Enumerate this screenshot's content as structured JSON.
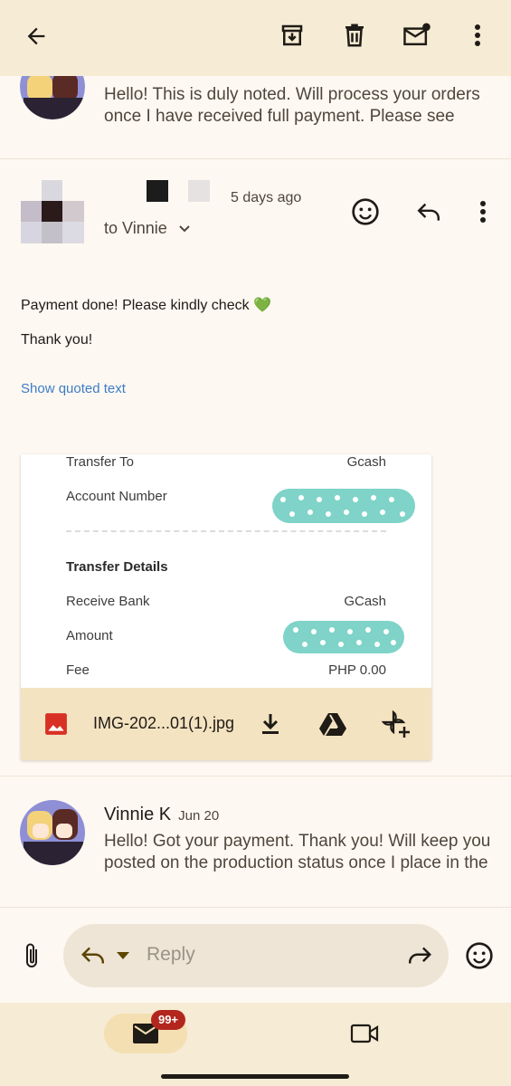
{
  "topbar": {
    "back_icon": "arrow-left-icon",
    "archive_icon": "archive-icon",
    "delete_icon": "trash-icon",
    "unread_icon": "mark-unread-icon",
    "more_icon": "more-vert-icon"
  },
  "thread": {
    "first_message_preview": "Hello! This is duly noted. Will process your orders once I have received full payment. Please see",
    "open_message": {
      "timestamp": "5 days ago",
      "to_label": "to Vinnie",
      "body_line1": "Payment done! Please kindly check 💚",
      "body_line2": "Thank you!",
      "show_quoted": "Show quoted text",
      "attachment": {
        "rows": [
          {
            "label": "Transfer To",
            "value": "Gcash"
          },
          {
            "label": "Account Number",
            "value": ""
          },
          {
            "label": "Transfer Details",
            "value": ""
          },
          {
            "label": "Receive Bank",
            "value": "GCash"
          },
          {
            "label": "Amount",
            "value": ""
          },
          {
            "label": "Fee",
            "value": "PHP 0.00"
          }
        ],
        "filename": "IMG-202...01(1).jpg",
        "download_icon": "download-icon",
        "drive_icon": "google-drive-icon",
        "photos_icon": "add-to-photos-icon"
      }
    },
    "last_message": {
      "sender": "Vinnie K",
      "date": "Jun 20",
      "preview": "Hello! Got your payment. Thank you! Will keep you posted on the production status once I place in the"
    }
  },
  "reply_bar": {
    "placeholder": "Reply",
    "attach_icon": "paperclip-icon",
    "emoji_icon": "emoji-icon"
  },
  "bottom_nav": {
    "mail_badge": "99+",
    "mail_icon": "mail-icon",
    "meet_icon": "video-camera-icon"
  },
  "colors": {
    "topbar": "#f6ebd4",
    "background": "#fdf8f1",
    "link": "#3d7cc9",
    "teal_scribble": "#7fd3c8",
    "badge": "#b3261e"
  }
}
